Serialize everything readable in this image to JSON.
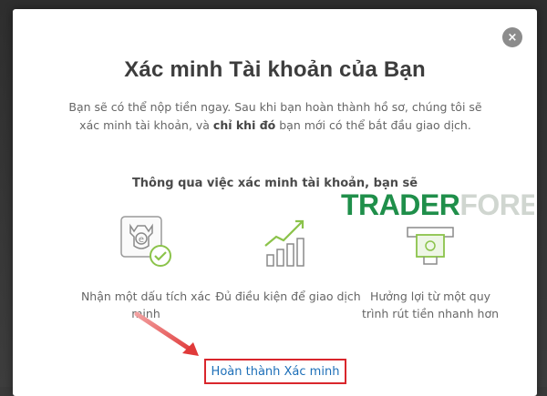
{
  "modal": {
    "close_glyph": "×",
    "title": "Xác minh Tài khoản của Bạn",
    "description": {
      "part1": "Bạn sẽ có thể nộp tiền ngay. Sau khi bạn hoàn thành hồ sơ, chúng tôi sẽ xác minh tài khoản, và ",
      "bold": "chỉ khi đó",
      "part2": " bạn mới có thể bắt đầu giao dịch."
    },
    "subheading": "Thông qua việc xác minh tài khoản, bạn sẽ",
    "features": [
      {
        "icon": "verified-badge-icon",
        "label": "Nhận một dấu tích xác minh"
      },
      {
        "icon": "growth-chart-icon",
        "label": "Đủ điều kiện để giao dịch"
      },
      {
        "icon": "atm-cash-icon",
        "label": "Hưởng lợi từ một quy trình rút tiền nhanh hơn"
      }
    ],
    "cta_label": "Hoàn thành Xác minh"
  },
  "watermark": {
    "part_a": "TRADER",
    "part_b": "FOREX"
  },
  "colors": {
    "accent_green": "#1f8f4a",
    "link_blue": "#1d6fb8",
    "highlight_red": "#d9262c"
  }
}
